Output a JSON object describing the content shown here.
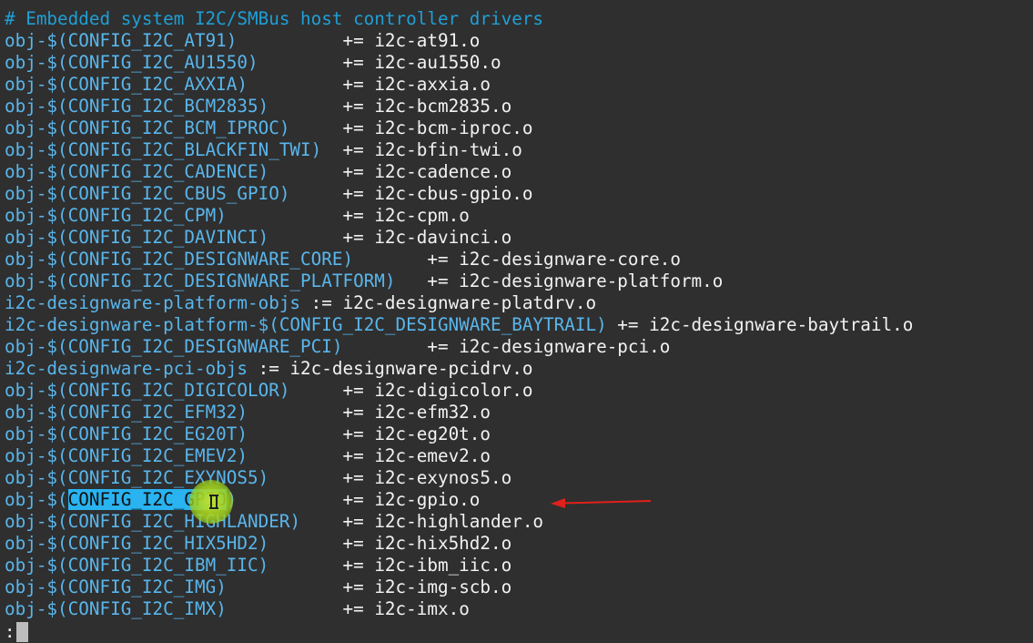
{
  "comment": "# Embedded system I2C/SMBus host controller drivers",
  "rows": [
    {
      "pre": "obj-$(",
      "var": "CONFIG_I2C_AT91",
      "post": ")",
      "pad": "          ",
      "op": "+=",
      "obj": "i2c-at91.o"
    },
    {
      "pre": "obj-$(",
      "var": "CONFIG_I2C_AU1550",
      "post": ")",
      "pad": "        ",
      "op": "+=",
      "obj": "i2c-au1550.o"
    },
    {
      "pre": "obj-$(",
      "var": "CONFIG_I2C_AXXIA",
      "post": ")",
      "pad": "         ",
      "op": "+=",
      "obj": "i2c-axxia.o"
    },
    {
      "pre": "obj-$(",
      "var": "CONFIG_I2C_BCM2835",
      "post": ")",
      "pad": "       ",
      "op": "+=",
      "obj": "i2c-bcm2835.o"
    },
    {
      "pre": "obj-$(",
      "var": "CONFIG_I2C_BCM_IPROC",
      "post": ")",
      "pad": "     ",
      "op": "+=",
      "obj": "i2c-bcm-iproc.o"
    },
    {
      "pre": "obj-$(",
      "var": "CONFIG_I2C_BLACKFIN_TWI",
      "post": ")",
      "pad": "  ",
      "op": "+=",
      "obj": "i2c-bfin-twi.o"
    },
    {
      "pre": "obj-$(",
      "var": "CONFIG_I2C_CADENCE",
      "post": ")",
      "pad": "       ",
      "op": "+=",
      "obj": "i2c-cadence.o"
    },
    {
      "pre": "obj-$(",
      "var": "CONFIG_I2C_CBUS_GPIO",
      "post": ")",
      "pad": "     ",
      "op": "+=",
      "obj": "i2c-cbus-gpio.o"
    },
    {
      "pre": "obj-$(",
      "var": "CONFIG_I2C_CPM",
      "post": ")",
      "pad": "           ",
      "op": "+=",
      "obj": "i2c-cpm.o"
    },
    {
      "pre": "obj-$(",
      "var": "CONFIG_I2C_DAVINCI",
      "post": ")",
      "pad": "       ",
      "op": "+=",
      "obj": "i2c-davinci.o"
    },
    {
      "pre": "obj-$(",
      "var": "CONFIG_I2C_DESIGNWARE_CORE",
      "post": ")",
      "pad": "       ",
      "op": "+=",
      "obj": "i2c-designware-core.o"
    },
    {
      "pre": "obj-$(",
      "var": "CONFIG_I2C_DESIGNWARE_PLATFORM",
      "post": ")",
      "pad": "   ",
      "op": "+=",
      "obj": "i2c-designware-platform.o"
    },
    {
      "pre": "i2c-designware-platform-objs",
      "var": "",
      "post": "",
      "pad": " ",
      "op": ":=",
      "obj": "i2c-designware-platdrv.o"
    },
    {
      "pre": "i2c-designware-platform-$(",
      "var": "CONFIG_I2C_DESIGNWARE_BAYTRAIL",
      "post": ")",
      "pad": " ",
      "op": "+=",
      "obj": "i2c-designware-baytrail.o"
    },
    {
      "pre": "obj-$(",
      "var": "CONFIG_I2C_DESIGNWARE_PCI",
      "post": ")",
      "pad": "        ",
      "op": "+=",
      "obj": "i2c-designware-pci.o"
    },
    {
      "pre": "i2c-designware-pci-objs",
      "var": "",
      "post": "",
      "pad": " ",
      "op": ":=",
      "obj": "i2c-designware-pcidrv.o"
    },
    {
      "pre": "obj-$(",
      "var": "CONFIG_I2C_DIGICOLOR",
      "post": ")",
      "pad": "     ",
      "op": "+=",
      "obj": "i2c-digicolor.o"
    },
    {
      "pre": "obj-$(",
      "var": "CONFIG_I2C_EFM32",
      "post": ")",
      "pad": "         ",
      "op": "+=",
      "obj": "i2c-efm32.o"
    },
    {
      "pre": "obj-$(",
      "var": "CONFIG_I2C_EG20T",
      "post": ")",
      "pad": "         ",
      "op": "+=",
      "obj": "i2c-eg20t.o"
    },
    {
      "pre": "obj-$(",
      "var": "CONFIG_I2C_EMEV2",
      "post": ")",
      "pad": "         ",
      "op": "+=",
      "obj": "i2c-emev2.o"
    },
    {
      "pre": "obj-$(",
      "var": "CONFIG_I2C_EXYNOS5",
      "post": ")",
      "pad": "       ",
      "op": "+=",
      "obj": "i2c-exynos5.o"
    },
    {
      "pre": "obj-$(",
      "var": "CONFIG_I2C_GPIO",
      "post": ")",
      "pad": "          ",
      "op": "+=",
      "obj": "i2c-gpio.o",
      "selected": true
    },
    {
      "pre": "obj-$(",
      "var": "CONFIG_I2C_HIGHLANDER",
      "post": ")",
      "pad": "    ",
      "op": "+=",
      "obj": "i2c-highlander.o"
    },
    {
      "pre": "obj-$(",
      "var": "CONFIG_I2C_HIX5HD2",
      "post": ")",
      "pad": "       ",
      "op": "+=",
      "obj": "i2c-hix5hd2.o"
    },
    {
      "pre": "obj-$(",
      "var": "CONFIG_I2C_IBM_IIC",
      "post": ")",
      "pad": "       ",
      "op": "+=",
      "obj": "i2c-ibm_iic.o"
    },
    {
      "pre": "obj-$(",
      "var": "CONFIG_I2C_IMG",
      "post": ")",
      "pad": "           ",
      "op": "+=",
      "obj": "i2c-img-scb.o"
    },
    {
      "pre": "obj-$(",
      "var": "CONFIG_I2C_IMX",
      "post": ")",
      "pad": "           ",
      "op": "+=",
      "obj": "i2c-imx.o"
    }
  ],
  "prompt": ":",
  "colors": {
    "background": "#2f2f2f",
    "comment": "#1f9fd6",
    "variable": "#59b6ec",
    "text": "#f2f2f2",
    "selection": "#29b3f0",
    "arrow": "#e0201a"
  }
}
